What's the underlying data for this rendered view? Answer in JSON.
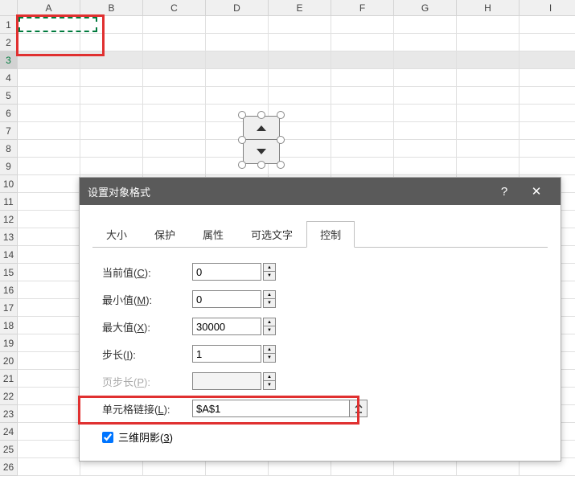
{
  "columns": [
    "A",
    "B",
    "C",
    "D",
    "E",
    "F",
    "G",
    "H",
    "I"
  ],
  "rows": [
    "1",
    "2",
    "3",
    "4",
    "5",
    "6",
    "7",
    "8",
    "9",
    "10",
    "11",
    "12",
    "13",
    "14",
    "15",
    "16",
    "17",
    "18",
    "19",
    "20",
    "21",
    "22",
    "23",
    "24",
    "25",
    "26"
  ],
  "selected_row_index": 2,
  "dialog": {
    "title": "设置对象格式",
    "help": "?",
    "close": "✕",
    "tabs": {
      "size": "大小",
      "protect": "保护",
      "properties": "属性",
      "alttext": "可选文字",
      "control": "控制"
    },
    "fields": {
      "current_label": "当前值(C):",
      "current_value": "0",
      "min_label": "最小值(M):",
      "min_value": "0",
      "max_label": "最大值(X):",
      "max_value": "30000",
      "step_label": "步长(I):",
      "step_value": "1",
      "pagestep_label": "页步长(P):",
      "pagestep_value": "",
      "link_label": "单元格链接(L):",
      "link_value": "$A$1"
    },
    "checkbox_label": "三维阴影(3)",
    "checkbox_checked": true
  }
}
